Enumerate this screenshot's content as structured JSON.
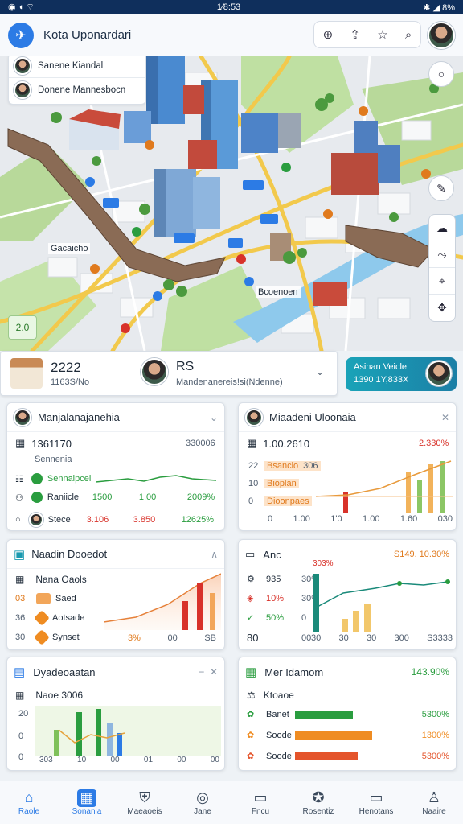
{
  "status": {
    "time": "1⁄8:53",
    "battery": "8%"
  },
  "header": {
    "title": "Kota Uponardari"
  },
  "map": {
    "location_popup": [
      {
        "label": "Sanene Kiandal"
      },
      {
        "label": "Donene Mannesbocn"
      }
    ],
    "labels": [
      "Gacaicho",
      "Bcoenoen"
    ],
    "corner_badge": "2.0"
  },
  "info_bar": {
    "value": "2222",
    "sub": "1163S/No",
    "title": "RS",
    "desc": "Mandenanereis!si(Ndenne)"
  },
  "promo": {
    "line1": "Asinan Veicle",
    "line2": "1390 1Y,833X"
  },
  "panels": {
    "p1": {
      "title": "Manjalanajanehia",
      "value": "1361170",
      "value_right": "330006",
      "sub": "Sennenia",
      "rows": [
        {
          "label": "Sennaipcel"
        },
        {
          "label": "Raniicle",
          "a": "1500",
          "b": "1.00",
          "c": "2009%"
        },
        {
          "label": "Stece",
          "a": "3.106",
          "b": "3.850",
          "c": "12625%"
        }
      ]
    },
    "p2": {
      "title": "Miaadeni Uloonaia",
      "value": "1.00.2610",
      "value_right": "2.330%",
      "y_ticks": [
        "22",
        "10",
        "0"
      ],
      "legend": [
        "Bsancio",
        "Bioplan",
        "Dioonpaes"
      ],
      "legend_val": "306",
      "x_ticks": [
        "0",
        "1.00",
        "1'0",
        "1.00",
        "1.60",
        "030"
      ]
    },
    "p3": {
      "title": "Naadin Dooedot",
      "row1": "Nana Oaols",
      "rows": [
        {
          "prefix": "03",
          "label": "Saed"
        },
        {
          "prefix": "36",
          "label": "Aotsade"
        },
        {
          "prefix": "30",
          "label": "Synset"
        }
      ],
      "x_ticks": [
        "3%",
        "00",
        "SB"
      ]
    },
    "p4": {
      "title": "Anc",
      "value_right": "S149. 10.30%",
      "head_val": "303%",
      "rows": [
        {
          "label": "935",
          "pct": "30%"
        },
        {
          "label": "10%",
          "pct": "30%"
        },
        {
          "label": "50%",
          "pct": "0"
        },
        {
          "label": "80",
          "pct": "00"
        }
      ],
      "x_ticks": [
        "30",
        "30",
        "30",
        "300",
        "S3333"
      ]
    },
    "p5": {
      "title": "Dyadeoaatan",
      "row1": "Naoe 3006",
      "y_ticks": [
        "20",
        "0",
        "0"
      ],
      "x_ticks": [
        "303",
        "10",
        "00",
        "01",
        "00",
        "00"
      ]
    },
    "p6": {
      "title": "Mer Idamom",
      "value_right": "143.90%",
      "row1": "Ktoaoe",
      "bars": [
        {
          "label": "Banet",
          "pct": "5300%",
          "fill": 0.6,
          "color": "#2a9d3f"
        },
        {
          "label": "Soode",
          "pct": "1300%",
          "fill": 0.8,
          "color": "#ef8c22"
        },
        {
          "label": "Soode",
          "pct": "5300%",
          "fill": 0.65,
          "color": "#e4542b"
        }
      ]
    }
  },
  "nav": [
    {
      "label": "Raole",
      "icon": "home-icon"
    },
    {
      "label": "Sonania",
      "icon": "dashboard-icon"
    },
    {
      "label": "Maeaoeis",
      "icon": "shield-icon"
    },
    {
      "label": "Jane",
      "icon": "help-icon"
    },
    {
      "label": "Fncu",
      "icon": "photo-icon"
    },
    {
      "label": "Rosentiz",
      "icon": "badge-icon"
    },
    {
      "label": "Henotans",
      "icon": "chart-icon"
    },
    {
      "label": "Naaire",
      "icon": "profile-icon"
    }
  ]
}
